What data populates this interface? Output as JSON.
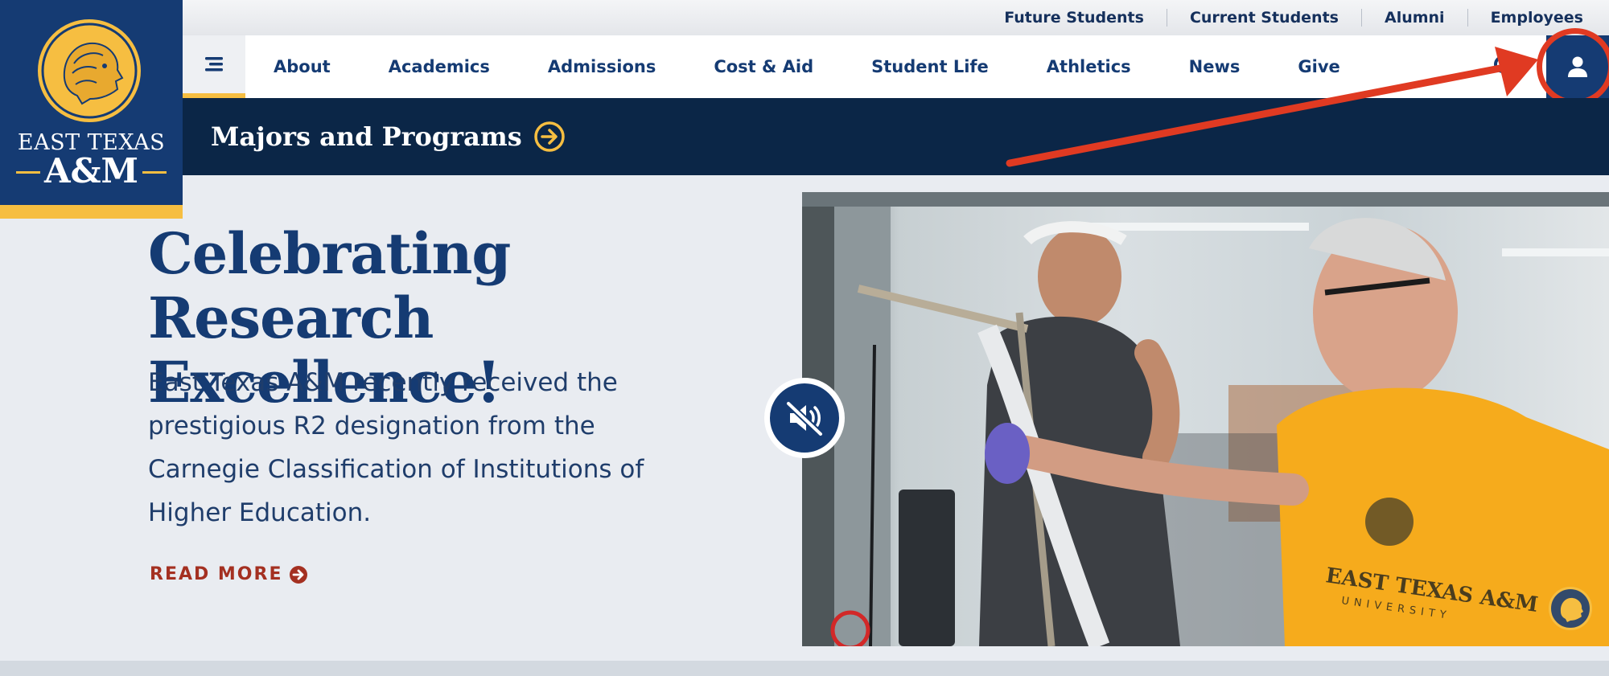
{
  "utility_nav": [
    "Future Students",
    "Current Students",
    "Alumni",
    "Employees"
  ],
  "logo": {
    "line1": "EAST TEXAS",
    "line2": "A&M"
  },
  "main_nav": [
    "About",
    "Academics",
    "Admissions",
    "Cost & Aid",
    "Student Life",
    "Athletics",
    "News",
    "Give"
  ],
  "majors": {
    "label": "Majors and Programs"
  },
  "hero": {
    "title_line1": "Celebrating",
    "title_line2": "Research Excellence!",
    "body": "East Texas A&M recently received the prestigious R2 designation from the Carnegie Classification of Institutions of Higher Education.",
    "read_more": "READ MORE"
  },
  "image_shirt": {
    "line1": "EAST TEXAS A&M",
    "line2": "UNIVERSITY"
  },
  "colors": {
    "navy": "#153b73",
    "dark_navy": "#0b2647",
    "gold": "#f6be41",
    "accent_red": "#e03a22"
  },
  "icons": {
    "menu": "menu-icon",
    "search": "search-icon",
    "account": "user-icon",
    "mute": "mute-icon"
  }
}
